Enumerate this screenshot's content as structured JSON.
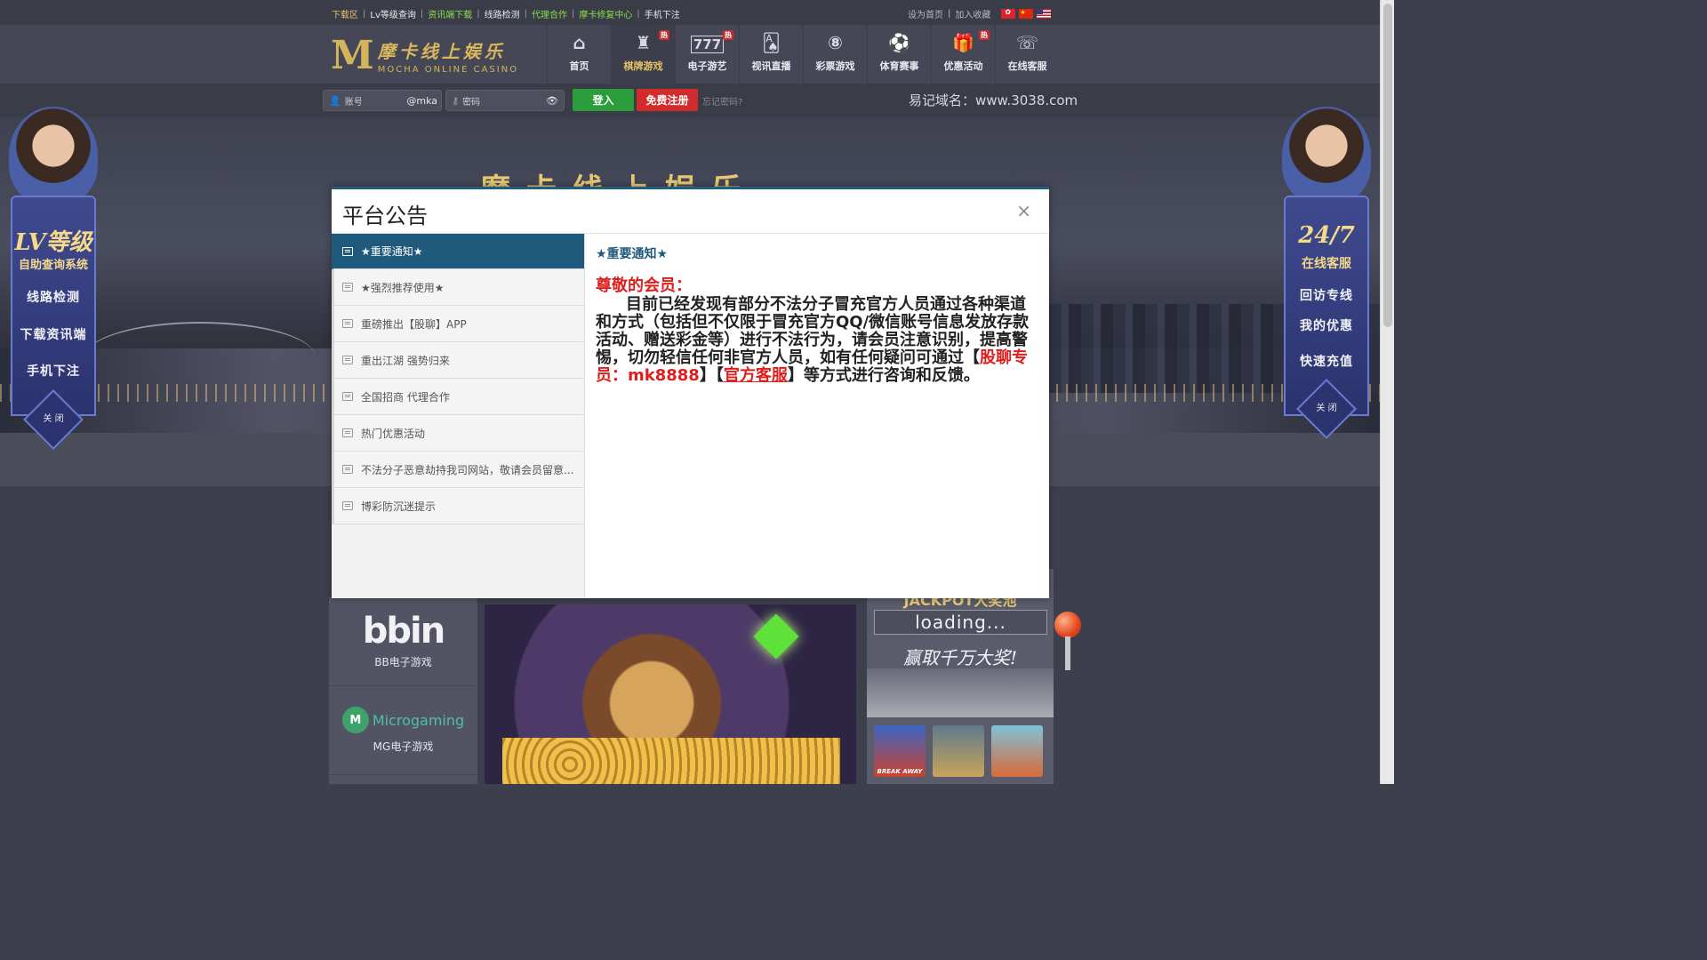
{
  "topbar": {
    "links": [
      {
        "label": "下载区",
        "color": "#e6c36a"
      },
      {
        "label": "Lv等级查询",
        "color": "#e8e8ee"
      },
      {
        "label": "资讯端下载",
        "color": "#8bdc4a"
      },
      {
        "label": "线路检测",
        "color": "#e8e8ee"
      },
      {
        "label": "代理合作",
        "color": "#8bdc4a"
      },
      {
        "label": "摩卡修复中心",
        "color": "#8bdc4a"
      },
      {
        "label": "手机下注",
        "color": "#e8e8ee"
      }
    ],
    "set_home": "设为首页",
    "bookmark": "加入收藏",
    "flags": [
      "hk-flag",
      "cn-flag",
      "us-flag"
    ]
  },
  "logo": {
    "mark": "M",
    "cn": "摩卡线上娱乐",
    "en": "MOCHA ONLINE CASINO"
  },
  "nav": [
    {
      "label": "首页",
      "icon": "⌂",
      "hot": ""
    },
    {
      "label": "棋牌游戏",
      "icon": "♜",
      "hot": "热"
    },
    {
      "label": "电子游艺",
      "icon": "777",
      "hot": "热"
    },
    {
      "label": "视讯直播",
      "icon": "🂡",
      "hot": ""
    },
    {
      "label": "彩票游戏",
      "icon": "⑧",
      "hot": ""
    },
    {
      "label": "体育赛事",
      "icon": "⚽",
      "hot": ""
    },
    {
      "label": "优惠活动",
      "icon": "🎁",
      "hot": "热"
    },
    {
      "label": "在线客服",
      "icon": "☏",
      "hot": ""
    }
  ],
  "login": {
    "account_placeholder": "账号",
    "account_suffix": "@mka",
    "password_placeholder": "密码",
    "login_label": "登入",
    "register_label": "免费注册",
    "forgot_label": "忘记密码?",
    "domain_text": "易记域名：www.3038.com"
  },
  "banner": {
    "title_peek": "摩卡线上娱乐"
  },
  "left_float": {
    "headline_top": "LV等级",
    "headline_bottom": "自助查询系统",
    "items": [
      "线路检测",
      "下载资讯端",
      "手机下注"
    ],
    "close": "关 闭"
  },
  "right_float": {
    "headline_top": "24/7",
    "headline_bottom": "在线客服",
    "items": [
      "回访专线",
      "我的优惠",
      "快速充值"
    ],
    "close": "关 闭"
  },
  "providers": [
    {
      "brand": "bbin",
      "label": "BB电子游戏"
    },
    {
      "brand": "Microgaming",
      "label": "MG电子游戏"
    }
  ],
  "jackpot": {
    "title": "JACKPOT大奖池",
    "loading": "loading...",
    "slogan": "赢取千万大奖!",
    "thumb_caption": "BREAK AWAY"
  },
  "modal": {
    "title": "平台公告",
    "close_icon": "×",
    "notices": [
      "★重要通知★",
      "★强烈推荐使用★",
      "重磅推出【股聊】APP",
      "重出江湖 强势归来",
      "全国招商 代理合作",
      "热门优惠活动",
      "不法分子恶意劫持我司网站，敬请会员留意...",
      "博彩防沉迷提示"
    ],
    "active_index": 0,
    "body": {
      "heading": "★重要通知★",
      "greeting": "尊敬的会员：",
      "text_1": "目前已经发现有部分不法分子冒充官方人员通过各种渠道和方式（包括但不仅限于冒充官方QQ/微信账号信息发放存款活动、赠送彩金等）进行不法行为，请会员注意识别，提高警惕，切勿轻信任何非官方人员，如有任何疑问可通过【",
      "highlight": "股聊专员：mk8888",
      "text_2": "】【",
      "link": "官方客服",
      "text_3": "】等方式进行咨询和反馈。"
    }
  },
  "colors": {
    "accent_gold": "#e6c36a",
    "login_green": "#2b9e3b",
    "register_red": "#d22b2b",
    "notice_active": "#1f5a7c",
    "alert_red": "#e01d1d"
  }
}
